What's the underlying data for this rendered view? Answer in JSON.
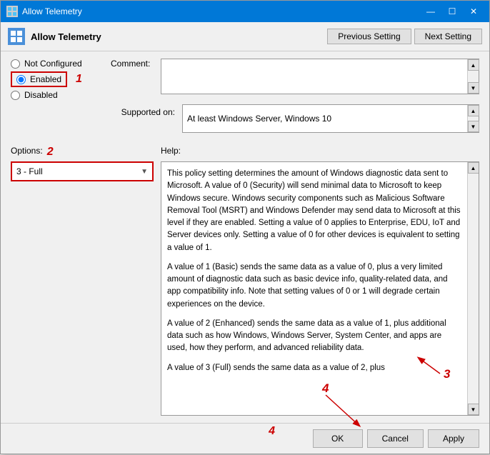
{
  "window": {
    "title": "Allow Telemetry",
    "header_title": "Allow Telemetry"
  },
  "title_bar": {
    "title": "Allow Telemetry",
    "minimize": "—",
    "maximize": "☐",
    "close": "✕"
  },
  "navigation": {
    "previous_label": "Previous Setting",
    "next_label": "Next Setting"
  },
  "radio": {
    "not_configured": "Not Configured",
    "enabled": "Enabled",
    "disabled": "Disabled"
  },
  "comment": {
    "label": "Comment:"
  },
  "supported": {
    "label": "Supported on:",
    "value": "At least Windows Server, Windows 10"
  },
  "options": {
    "label": "Options:",
    "dropdown_value": "3 - Full"
  },
  "help": {
    "label": "Help:",
    "text_p1": "This policy setting determines the amount of Windows diagnostic data sent to Microsoft. A value of 0 (Security) will send minimal data to Microsoft to keep Windows secure. Windows security components such as Malicious Software Removal Tool (MSRT) and Windows Defender may send data to Microsoft at this level if they are enabled. Setting a value of 0 applies to Enterprise, EDU, IoT and Server devices only. Setting a value of 0 for other devices is equivalent to setting a value of 1.",
    "text_p2": "A value of 1 (Basic) sends the same data as a value of 0, plus a very limited amount of diagnostic data such as basic device info, quality-related data, and app compatibility info. Note that setting values of 0 or 1 will degrade certain experiences on the device.",
    "text_p3": "A value of 2 (Enhanced) sends the same data as a value of 1, plus additional data such as how Windows, Windows Server, System Center, and apps are used, how they perform, and advanced reliability data.",
    "text_p4": "A value of 3 (Full) sends the same data as a value of 2, plus"
  },
  "footer": {
    "ok_label": "OK",
    "cancel_label": "Cancel",
    "apply_label": "Apply"
  },
  "annotations": {
    "num1": "1",
    "num2": "2",
    "num3": "3",
    "num4": "4"
  }
}
